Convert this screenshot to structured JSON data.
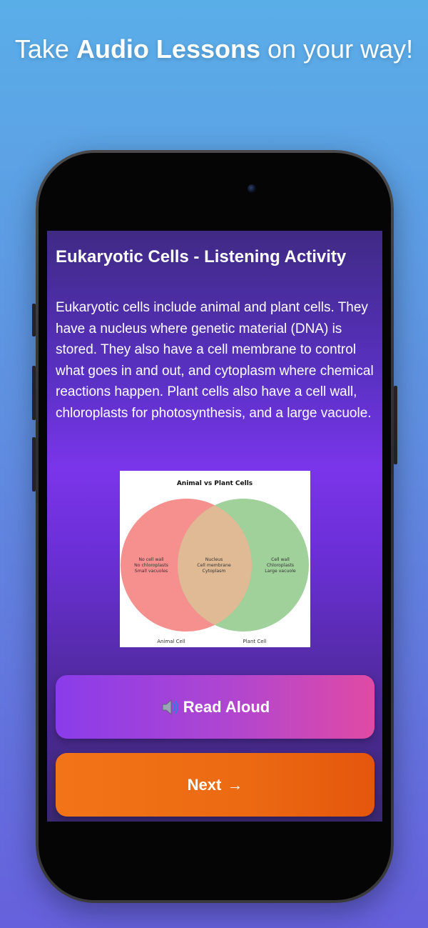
{
  "headline": {
    "prefix": "Take ",
    "emphasis": "Audio Lessons",
    "suffix": " on your way!"
  },
  "lesson": {
    "title": "Eukaryotic Cells - Listening Activity",
    "body": "Eukaryotic cells include animal and plant cells. They have a nucleus where genetic material (DNA) is stored. They also have a cell membrane to control what goes in and out, and cytoplasm where chemical reactions happen. Plant cells also have a cell wall, chloroplasts for photosynthesis, and a large vacuole."
  },
  "diagram": {
    "title": "Animal vs Plant Cells",
    "left_set_label": "Animal Cell",
    "right_set_label": "Plant Cell",
    "left_only": [
      "No cell wall",
      "No chloroplasts",
      "Small vacuoles"
    ],
    "shared": [
      "Nucleus",
      "Cell membrane",
      "Cytoplasm"
    ],
    "right_only": [
      "Cell wall",
      "Chloroplasts",
      "Large vacuole"
    ],
    "colors": {
      "left": "#f57d7a",
      "right": "#8fc98a",
      "overlap": "#e0b995"
    }
  },
  "buttons": {
    "read_aloud": {
      "icon": "speaker-icon",
      "label": "Read Aloud"
    },
    "next": {
      "label": "Next",
      "arrow": "→"
    }
  }
}
